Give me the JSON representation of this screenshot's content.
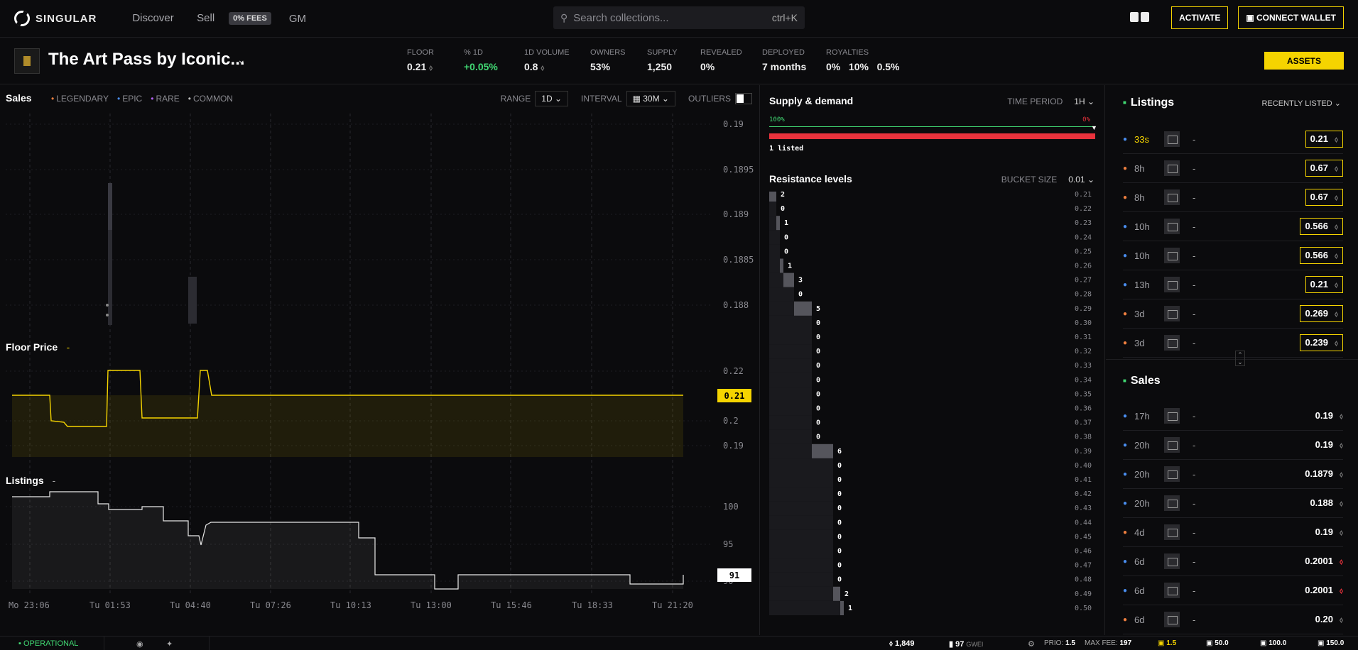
{
  "header": {
    "brand": "SINGULAR",
    "nav": [
      "Discover",
      "Sell"
    ],
    "fees_badge": "0% FEES",
    "gm": "GM",
    "search_placeholder": "Search collections...",
    "search_shortcut": "ctrl+K",
    "activate_label": "ACTIVATE",
    "connect_label": "CONNECT WALLET"
  },
  "collection": {
    "title": "The Art Pass by Iconic...",
    "stats": [
      {
        "label": "FLOOR",
        "value": "0.21",
        "eth": "⬨"
      },
      {
        "label": "% 1D",
        "value": "+0.05%",
        "green": true
      },
      {
        "label": "1D VOLUME",
        "value": "0.8",
        "eth": "⬨"
      },
      {
        "label": "OWNERS",
        "value": "53%"
      },
      {
        "label": "SUPPLY",
        "value": "1,250"
      },
      {
        "label": "REVEALED",
        "value": "0%"
      },
      {
        "label": "DEPLOYED",
        "value": "7 months"
      },
      {
        "label": "ROYALTIES",
        "value": "0%   10%   0.5%"
      }
    ],
    "assets_label": "ASSETS"
  },
  "sales_panel": {
    "title": "Sales",
    "legend": [
      "LEGENDARY",
      "EPIC",
      "RARE",
      "COMMON"
    ],
    "range_label": "RANGE",
    "range_value": "1D",
    "interval_label": "INTERVAL",
    "interval_value": "30M",
    "outliers_label": "OUTLIERS",
    "floor_title": "Floor Price",
    "floor_dash": "-",
    "listings_title": "Listings",
    "listings_dash": "-",
    "floor_current": "0.21",
    "listings_current": "91"
  },
  "chart_data": [
    {
      "type": "scatter",
      "title": "Sales",
      "y_ticks": [
        "0.19",
        "0.1895",
        "0.189",
        "0.1885",
        "0.188"
      ],
      "ylim": [
        0.1877,
        0.1903
      ]
    },
    {
      "type": "line",
      "title": "Floor Price",
      "y_ticks": [
        "0.22",
        "0.2",
        "0.19"
      ],
      "x": [
        0,
        1,
        2,
        3,
        4,
        5,
        6,
        7,
        8,
        9,
        10,
        11,
        12,
        13,
        14,
        15
      ],
      "values": [
        0.21,
        0.21,
        0.19,
        0.188,
        0.22,
        0.22,
        0.19,
        0.19,
        0.22,
        0.21,
        0.21,
        0.21,
        0.21,
        0.21,
        0.21,
        0.21
      ]
    },
    {
      "type": "area",
      "title": "Listings",
      "y_ticks": [
        "100",
        "95",
        "90"
      ],
      "values": [
        102,
        103,
        101,
        100,
        100,
        98,
        96,
        98,
        98,
        98,
        96,
        91,
        91,
        89,
        91,
        91,
        91,
        90,
        91
      ]
    }
  ],
  "x_axis": [
    "Mo 23:06",
    "Tu 01:53",
    "Tu 04:40",
    "Tu 07:26",
    "Tu 10:13",
    "Tu 13:00",
    "Tu 15:46",
    "Tu 18:33",
    "Tu 21:20"
  ],
  "supply": {
    "title": "Supply & demand",
    "period_label": "TIME PERIOD",
    "period_value": "1H",
    "left_pct": "100%",
    "right_pct": "0%",
    "listed_text": "1 listed"
  },
  "resistance": {
    "title": "Resistance levels",
    "bucket_label": "BUCKET SIZE",
    "bucket_value": "0.01",
    "levels": [
      {
        "price": "0.21",
        "count": 2
      },
      {
        "price": "0.22",
        "count": 0
      },
      {
        "price": "0.23",
        "count": 1
      },
      {
        "price": "0.24",
        "count": 0
      },
      {
        "price": "0.25",
        "count": 0
      },
      {
        "price": "0.26",
        "count": 1
      },
      {
        "price": "0.27",
        "count": 3
      },
      {
        "price": "0.28",
        "count": 0
      },
      {
        "price": "0.29",
        "count": 5
      },
      {
        "price": "0.30",
        "count": 0
      },
      {
        "price": "0.31",
        "count": 0
      },
      {
        "price": "0.32",
        "count": 0
      },
      {
        "price": "0.33",
        "count": 0
      },
      {
        "price": "0.34",
        "count": 0
      },
      {
        "price": "0.35",
        "count": 0
      },
      {
        "price": "0.36",
        "count": 0
      },
      {
        "price": "0.37",
        "count": 0
      },
      {
        "price": "0.38",
        "count": 0
      },
      {
        "price": "0.39",
        "count": 6
      },
      {
        "price": "0.40",
        "count": 0
      },
      {
        "price": "0.41",
        "count": 0
      },
      {
        "price": "0.42",
        "count": 0
      },
      {
        "price": "0.43",
        "count": 0
      },
      {
        "price": "0.44",
        "count": 0
      },
      {
        "price": "0.45",
        "count": 0
      },
      {
        "price": "0.46",
        "count": 0
      },
      {
        "price": "0.47",
        "count": 0
      },
      {
        "price": "0.48",
        "count": 0
      },
      {
        "price": "0.49",
        "count": 2
      },
      {
        "price": "0.50",
        "count": 1
      }
    ]
  },
  "listings": {
    "title": "Listings",
    "sort_label": "RECENTLY LISTED",
    "rows": [
      {
        "time": "33s",
        "price": "0.21",
        "dot": "#4a8ef0",
        "new": true
      },
      {
        "time": "8h",
        "price": "0.67",
        "dot": "#f08040"
      },
      {
        "time": "8h",
        "price": "0.67",
        "dot": "#f08040"
      },
      {
        "time": "10h",
        "price": "0.566",
        "dot": "#4a8ef0"
      },
      {
        "time": "10h",
        "price": "0.566",
        "dot": "#4a8ef0"
      },
      {
        "time": "13h",
        "price": "0.21",
        "dot": "#4a8ef0"
      },
      {
        "time": "3d",
        "price": "0.269",
        "dot": "#f08040"
      },
      {
        "time": "3d",
        "price": "0.239",
        "dot": "#f08040"
      }
    ]
  },
  "sales": {
    "title": "Sales",
    "rows": [
      {
        "time": "17h",
        "price": "0.19",
        "dot": "#4a8ef0"
      },
      {
        "time": "20h",
        "price": "0.19",
        "dot": "#4a8ef0"
      },
      {
        "time": "20h",
        "price": "0.1879",
        "dot": "#4a8ef0"
      },
      {
        "time": "20h",
        "price": "0.188",
        "dot": "#4a8ef0"
      },
      {
        "time": "4d",
        "price": "0.19",
        "dot": "#f08040"
      },
      {
        "time": "6d",
        "price": "0.2001",
        "dot": "#4a8ef0",
        "red": true
      },
      {
        "time": "6d",
        "price": "0.2001",
        "dot": "#4a8ef0",
        "red": true
      },
      {
        "time": "6d",
        "price": "0.20",
        "dot": "#f08040"
      }
    ]
  },
  "footer": {
    "status": "OPERATIONAL",
    "eth_price": "1,849",
    "gas": "97",
    "gas_unit": "GWEI",
    "prio_label": "PRIO:",
    "prio_value": "1.5",
    "max_fee_label": "MAX FEE:",
    "max_fee_value": "197",
    "p1": "1.5",
    "p2": "50.0",
    "p3": "100.0",
    "p4": "150.0"
  },
  "colors": {
    "accent": "#f5d400",
    "green": "#41d873",
    "red": "#e8323c"
  }
}
